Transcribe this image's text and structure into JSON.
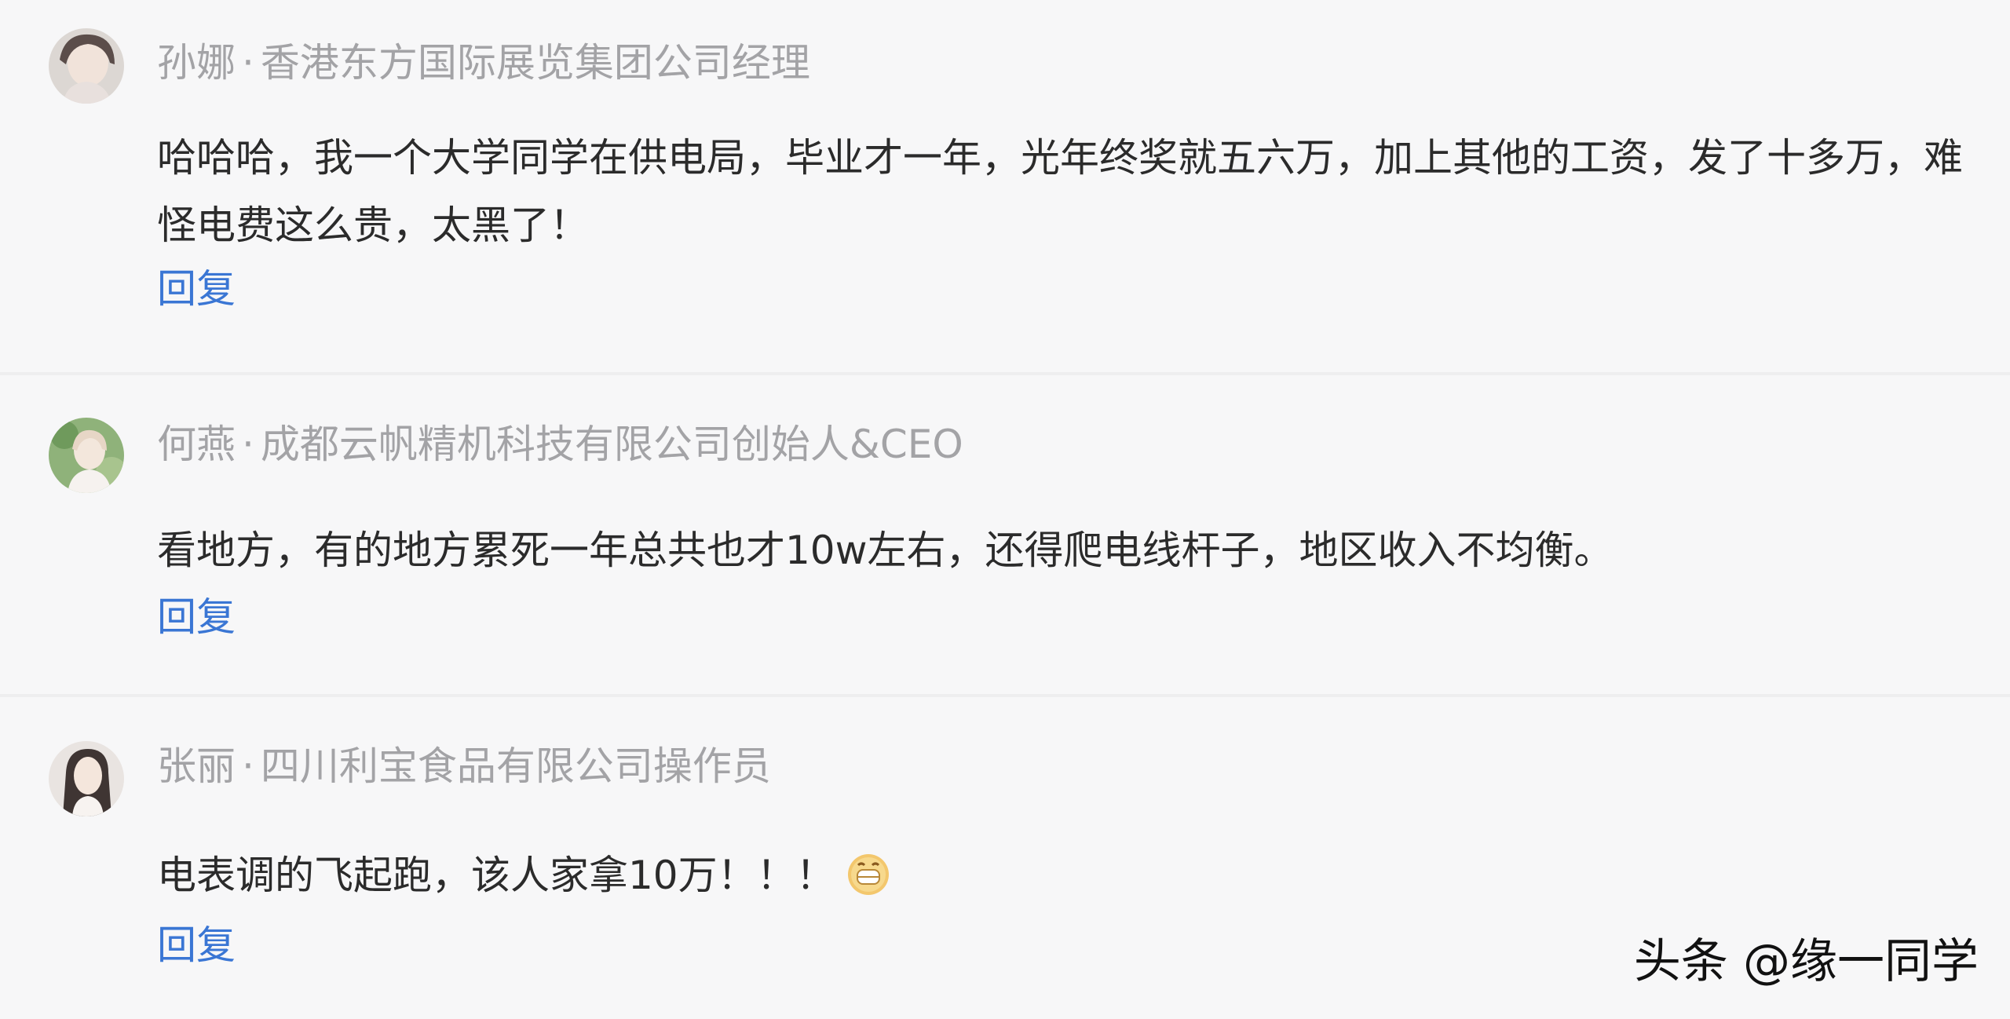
{
  "comments": [
    {
      "author": "孙娜",
      "separator": "·",
      "title": "香港东方国际展览集团公司经理",
      "text": "哈哈哈，我一个大学同学在供电局，毕业才一年，光年终奖就五六万，加上其他的工资，发了十多万，难怪电费这么贵，太黑了！",
      "reply_label": "回复"
    },
    {
      "author": "何燕",
      "separator": "·",
      "title": "成都云帆精机科技有限公司创始人&CEO",
      "text": "看地方，有的地方累死一年总共也才10w左右，还得爬电线杆子，地区收入不均衡。",
      "reply_label": "回复"
    },
    {
      "author": "张丽",
      "separator": "·",
      "title": "四川利宝食品有限公司操作员",
      "text": "电表调的飞起跑，该人家拿10万！！！",
      "emoji": "grinning-face-emoji",
      "reply_label": "回复"
    }
  ],
  "watermark": "头条 @缘一同学",
  "colors": {
    "background": "#f7f7f8",
    "meta_text": "#a3a3a6",
    "body_text": "#2b2b2b",
    "reply_link": "#3a76d4",
    "watermark": "#111111"
  }
}
